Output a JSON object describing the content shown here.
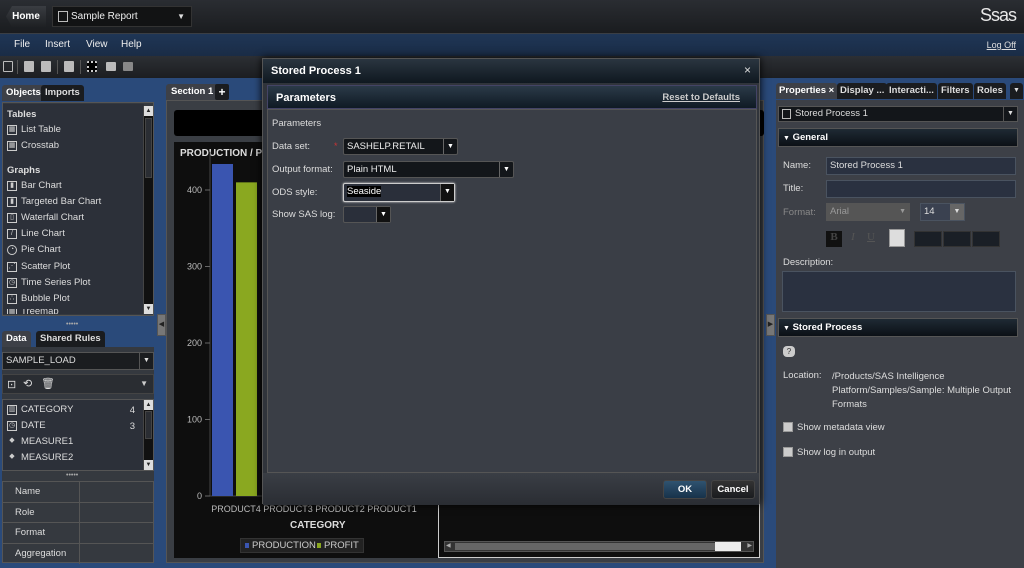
{
  "topbar": {
    "home_label": "Home",
    "report_name": "Sample Report",
    "logo": "Ssas"
  },
  "menubar": {
    "items": [
      "File",
      "Insert",
      "View",
      "Help"
    ],
    "logoff": "Log Off"
  },
  "toolbar": {
    "icons": [
      "new-report-icon",
      "open-icon",
      "save-icon",
      "page-icon",
      "fit-icon",
      "view-icon",
      "layout-icon"
    ]
  },
  "left": {
    "tabs": [
      "Objects",
      "Imports"
    ],
    "sections": [
      {
        "label": "Tables",
        "items": [
          "List Table",
          "Crosstab"
        ]
      },
      {
        "label": "Graphs",
        "items": [
          "Bar Chart",
          "Targeted Bar Chart",
          "Waterfall Chart",
          "Line Chart",
          "Pie Chart",
          "Scatter Plot",
          "Time Series Plot",
          "Bubble Plot",
          "Treemap"
        ]
      }
    ],
    "data_tabs": [
      "Data",
      "Shared Rules"
    ],
    "data_source": "SAMPLE_LOAD",
    "data_items": [
      {
        "name": "CATEGORY",
        "count": "4"
      },
      {
        "name": "DATE",
        "count": "3"
      },
      {
        "name": "MEASURE1",
        "count": ""
      },
      {
        "name": "MEASURE2",
        "count": ""
      }
    ],
    "property_rows": [
      "Name",
      "Role",
      "Format",
      "Aggregation"
    ]
  },
  "canvas": {
    "section_tab": "Section 1",
    "add_tab": "+"
  },
  "chart_data": {
    "type": "bar",
    "title": "PRODUCTION / PR",
    "xlabel": "CATEGORY",
    "ylabel": "",
    "categories": [
      "PRODUCT4",
      "PRODUCT3",
      "PRODUCT2",
      "PRODUCT1"
    ],
    "series": [
      {
        "name": "PRODUCTION",
        "color": "#3a55b0",
        "values": [
          434,
          null,
          null,
          null
        ]
      },
      {
        "name": "PROFIT",
        "color": "#8aa820",
        "values": [
          410,
          null,
          null,
          null
        ]
      }
    ],
    "yticks": [
      0,
      100,
      200,
      300,
      400
    ],
    "ylim": [
      0,
      450
    ],
    "legend": "bottom",
    "grid": false
  },
  "dialog": {
    "title": "Stored Process 1",
    "close": "×",
    "header": "Parameters",
    "reset": "Reset to Defaults",
    "group_label": "Parameters",
    "fields": [
      {
        "label": "Data set:",
        "value": "SASHELP.RETAIL",
        "required": true
      },
      {
        "label": "Output format:",
        "value": "Plain HTML",
        "required": false
      },
      {
        "label": "ODS style:",
        "value": "Seaside",
        "required": false
      },
      {
        "label": "Show SAS log:",
        "value": "",
        "required": false
      }
    ],
    "required_mark": "*",
    "ok": "OK",
    "cancel": "Cancel"
  },
  "right": {
    "tabs": [
      "Properties ×",
      "Display ...",
      "Interacti...",
      "Filters",
      "Roles"
    ],
    "object": "Stored Process 1",
    "general_header": "General",
    "name_label": "Name:",
    "name_value": "Stored Process 1",
    "title_label": "Title:",
    "title_value": "",
    "format_label": "Format:",
    "font_value": "Arial",
    "size_value": "14",
    "bold": "B",
    "italic": "I",
    "underline": "U",
    "description_label": "Description:",
    "sp_header": "Stored Process",
    "location_label": "Location:",
    "location_value": "/Products/SAS Intelligence Platform/Samples/Sample: Multiple Output Formats",
    "show_metadata": "Show metadata view",
    "show_log": "Show log in output"
  }
}
